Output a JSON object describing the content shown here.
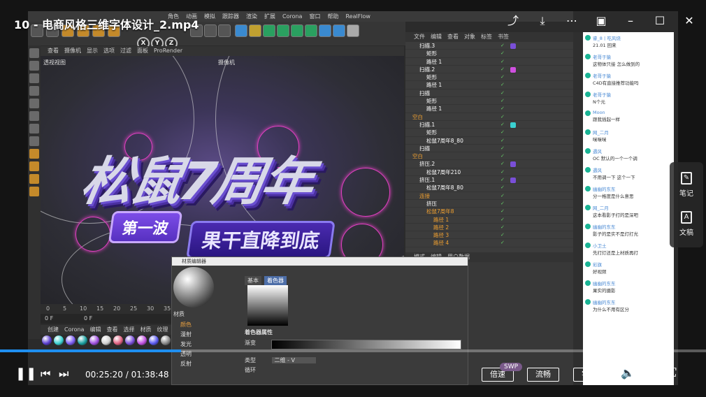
{
  "player": {
    "title": "10 - 电商风格三维字体设计_2.mp4",
    "time_current": "00:25:20",
    "time_total": "01:38:48",
    "time_sep": " / ",
    "progress": 0.2564,
    "speed_label": "倍速",
    "quality_label": "流畅",
    "subtitle_label": "字幕",
    "swp_badge": "SWP",
    "side_panel": {
      "notes_label": "笔记",
      "transcript_label": "文稿"
    },
    "accent_color": "#1f8ff0"
  },
  "c4d": {
    "menu": [
      "角色",
      "动画",
      "模拟",
      "跟踪器",
      "渲染",
      "扩展",
      "Corona",
      "窗口",
      "帮助",
      "RealFlow"
    ],
    "axis_buttons": [
      "X",
      "Y",
      "Z"
    ],
    "viewport_menu": [
      "查看",
      "摄像机",
      "显示",
      "选项",
      "过滤",
      "面板",
      "ProRender"
    ],
    "viewport_label": "透视视图",
    "camera_label": "摄像机",
    "timeline_ticks": [
      "0",
      "5",
      "10",
      "15",
      "20",
      "25",
      "30",
      "35"
    ],
    "frame_start": "0 F",
    "frame_current": "0 F",
    "material_menu": [
      "创建",
      "Corona",
      "编辑",
      "查看",
      "选择",
      "材质",
      "纹理"
    ],
    "material_ball_colors": [
      "#5a3fd0",
      "#3ad0d0",
      "#7a5cf0",
      "#1aa0a0",
      "#a050e0",
      "#d0d0d0",
      "#e06080",
      "#7a4fd8",
      "#c050e0",
      "#5a5af0",
      "#888",
      "#2a2a2a"
    ],
    "artwork_title": "松鼠7周年",
    "artwork_badge": "第一波",
    "artwork_slogan": "果干直降到底"
  },
  "object_manager": {
    "menu": [
      "文件",
      "编辑",
      "查看",
      "对象",
      "标签",
      "书签"
    ],
    "rows": [
      {
        "name": "扫描.3",
        "indent": 1,
        "color": "#fff",
        "tag": "#7a4fd8"
      },
      {
        "name": "矩形",
        "indent": 2,
        "color": "#fff",
        "tag": ""
      },
      {
        "name": "路径 1",
        "indent": 2,
        "color": "#fff",
        "tag": ""
      },
      {
        "name": "扫描.2",
        "indent": 1,
        "color": "#fff",
        "tag": "#d050e0"
      },
      {
        "name": "矩形",
        "indent": 2,
        "color": "#fff",
        "tag": ""
      },
      {
        "name": "路径 1",
        "indent": 2,
        "color": "#fff",
        "tag": ""
      },
      {
        "name": "扫描",
        "indent": 1,
        "color": "#fff",
        "tag": ""
      },
      {
        "name": "矩形",
        "indent": 2,
        "color": "#fff",
        "tag": ""
      },
      {
        "name": "路径 1",
        "indent": 2,
        "color": "#fff",
        "tag": ""
      },
      {
        "name": "空白",
        "indent": 0,
        "color": "#f0a030",
        "tag": ""
      },
      {
        "name": "扫描.1",
        "indent": 1,
        "color": "#fff",
        "tag": "#3ad0d0"
      },
      {
        "name": "矩形",
        "indent": 2,
        "color": "#fff",
        "tag": ""
      },
      {
        "name": "松鼠7周年8_80",
        "indent": 2,
        "color": "#fff",
        "tag": ""
      },
      {
        "name": "扫描",
        "indent": 1,
        "color": "#fff",
        "tag": ""
      },
      {
        "name": "空白",
        "indent": 0,
        "color": "#f0a030",
        "tag": ""
      },
      {
        "name": "挤压.2",
        "indent": 1,
        "color": "#fff",
        "tag": "#7a4fd8"
      },
      {
        "name": "松鼠7周年210",
        "indent": 2,
        "color": "#fff",
        "tag": ""
      },
      {
        "name": "挤压.1",
        "indent": 1,
        "color": "#fff",
        "tag": "#7a4fd8"
      },
      {
        "name": "松鼠7周年8_80",
        "indent": 2,
        "color": "#fff",
        "tag": ""
      },
      {
        "name": "连接",
        "indent": 1,
        "color": "#f0a030",
        "tag": ""
      },
      {
        "name": "挤压",
        "indent": 2,
        "color": "#fff",
        "tag": ""
      },
      {
        "name": "松鼠7周年8",
        "indent": 2,
        "color": "#f0a030",
        "tag": ""
      },
      {
        "name": "路径 1",
        "indent": 3,
        "color": "#f0a030",
        "tag": ""
      },
      {
        "name": "路径 2",
        "indent": 3,
        "color": "#f0a030",
        "tag": ""
      },
      {
        "name": "路径 3",
        "indent": 3,
        "color": "#f0a030",
        "tag": ""
      },
      {
        "name": "路径 4",
        "indent": 3,
        "color": "#f0a030",
        "tag": ""
      }
    ]
  },
  "attribute_panel": {
    "menu": [
      "模式",
      "编辑",
      "用户数据"
    ],
    "tabs": [
      "基本",
      "显示"
    ]
  },
  "material_editor": {
    "title": "材质编辑器",
    "tabs": [
      "基本",
      "着色器"
    ],
    "material_name": "材质",
    "channels": [
      "颜色",
      "漫射",
      "发光",
      "透明",
      "反射"
    ],
    "prop_title": "着色器属性",
    "prop_gradient": "渐变",
    "prop_type": "类型",
    "prop_type_value": "二维 - V",
    "prop_loop": "循环"
  },
  "chat": {
    "messages": [
      {
        "name": "睿_8丨吃风烧",
        "text": "21.01 回来"
      },
      {
        "name": "老哥于猿",
        "text": "这物体只接 怎么做到的"
      },
      {
        "name": "老哥于猿",
        "text": "C4D有直接推荐功能吗"
      },
      {
        "name": "老哥于猿",
        "text": "N个元"
      },
      {
        "name": "Moon",
        "text": "跟我插起一样"
      },
      {
        "name": "网_二月",
        "text": "咪咪咪"
      },
      {
        "name": "遇风",
        "text": "OC 默认的一个一个调"
      },
      {
        "name": "遇风",
        "text": "不用调一下 这个一下"
      },
      {
        "name": "幽幽的东东",
        "text": "分一格度是什么意思"
      },
      {
        "name": "网_二月",
        "text": "这本看影子打的是深吧"
      },
      {
        "name": "幽幽的东东",
        "text": "影子的是实不是灯打光"
      },
      {
        "name": "小卫土",
        "text": "先打灯还是上材质再打"
      },
      {
        "name": "彩旗",
        "text": "好视频"
      },
      {
        "name": "幽幽的东东",
        "text": "果实的摄影"
      },
      {
        "name": "幽幽的东东",
        "text": "为什么不用有区分"
      }
    ]
  }
}
